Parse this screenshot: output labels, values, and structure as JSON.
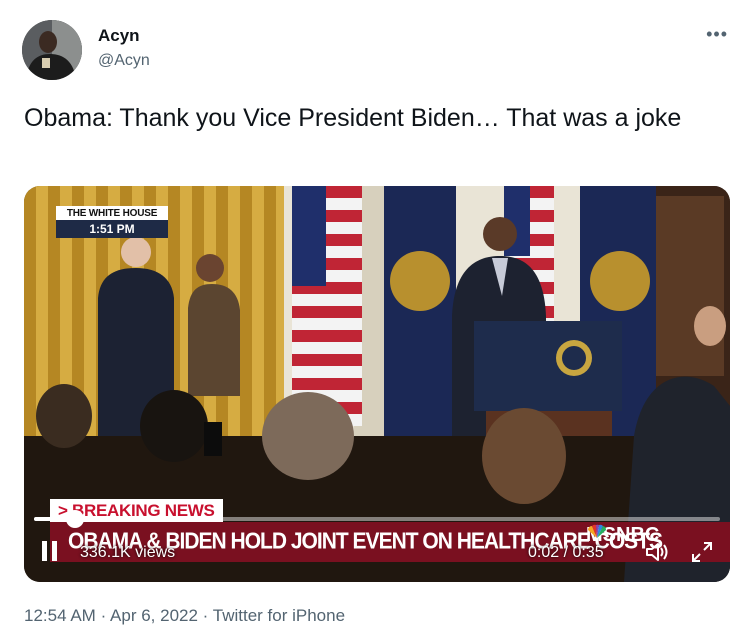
{
  "author": {
    "name": "Acyn",
    "handle": "@Acyn",
    "avatar_icon": "user-avatar"
  },
  "more_icon": "more-icon",
  "tweet": {
    "text": "Obama: Thank you Vice President Biden… That was a joke"
  },
  "media": {
    "badge_source": "THE WHITE HOUSE",
    "badge_time": "1:51 PM",
    "breaking_label": "> BREAKING NEWS",
    "headline": "OBAMA & BIDEN HOLD JOINT EVENT ON HEALTHCARE COSTS",
    "network": "MSNBC",
    "views": "336.1K views",
    "time": "0:02 / 0:35",
    "progress_fraction": 0.06,
    "controls": {
      "play_state": "pause-icon",
      "volume": "volume-icon",
      "fullscreen": "fullscreen-icon"
    }
  },
  "timestamp": {
    "time": "12:54 AM",
    "separator": "·",
    "date": "Apr 6, 2022",
    "client": "Twitter for iPhone"
  },
  "colors": {
    "text_primary": "#0f1419",
    "text_secondary": "#536471",
    "breaking_red": "#c8102e",
    "headline_bar": "#7a1020"
  }
}
